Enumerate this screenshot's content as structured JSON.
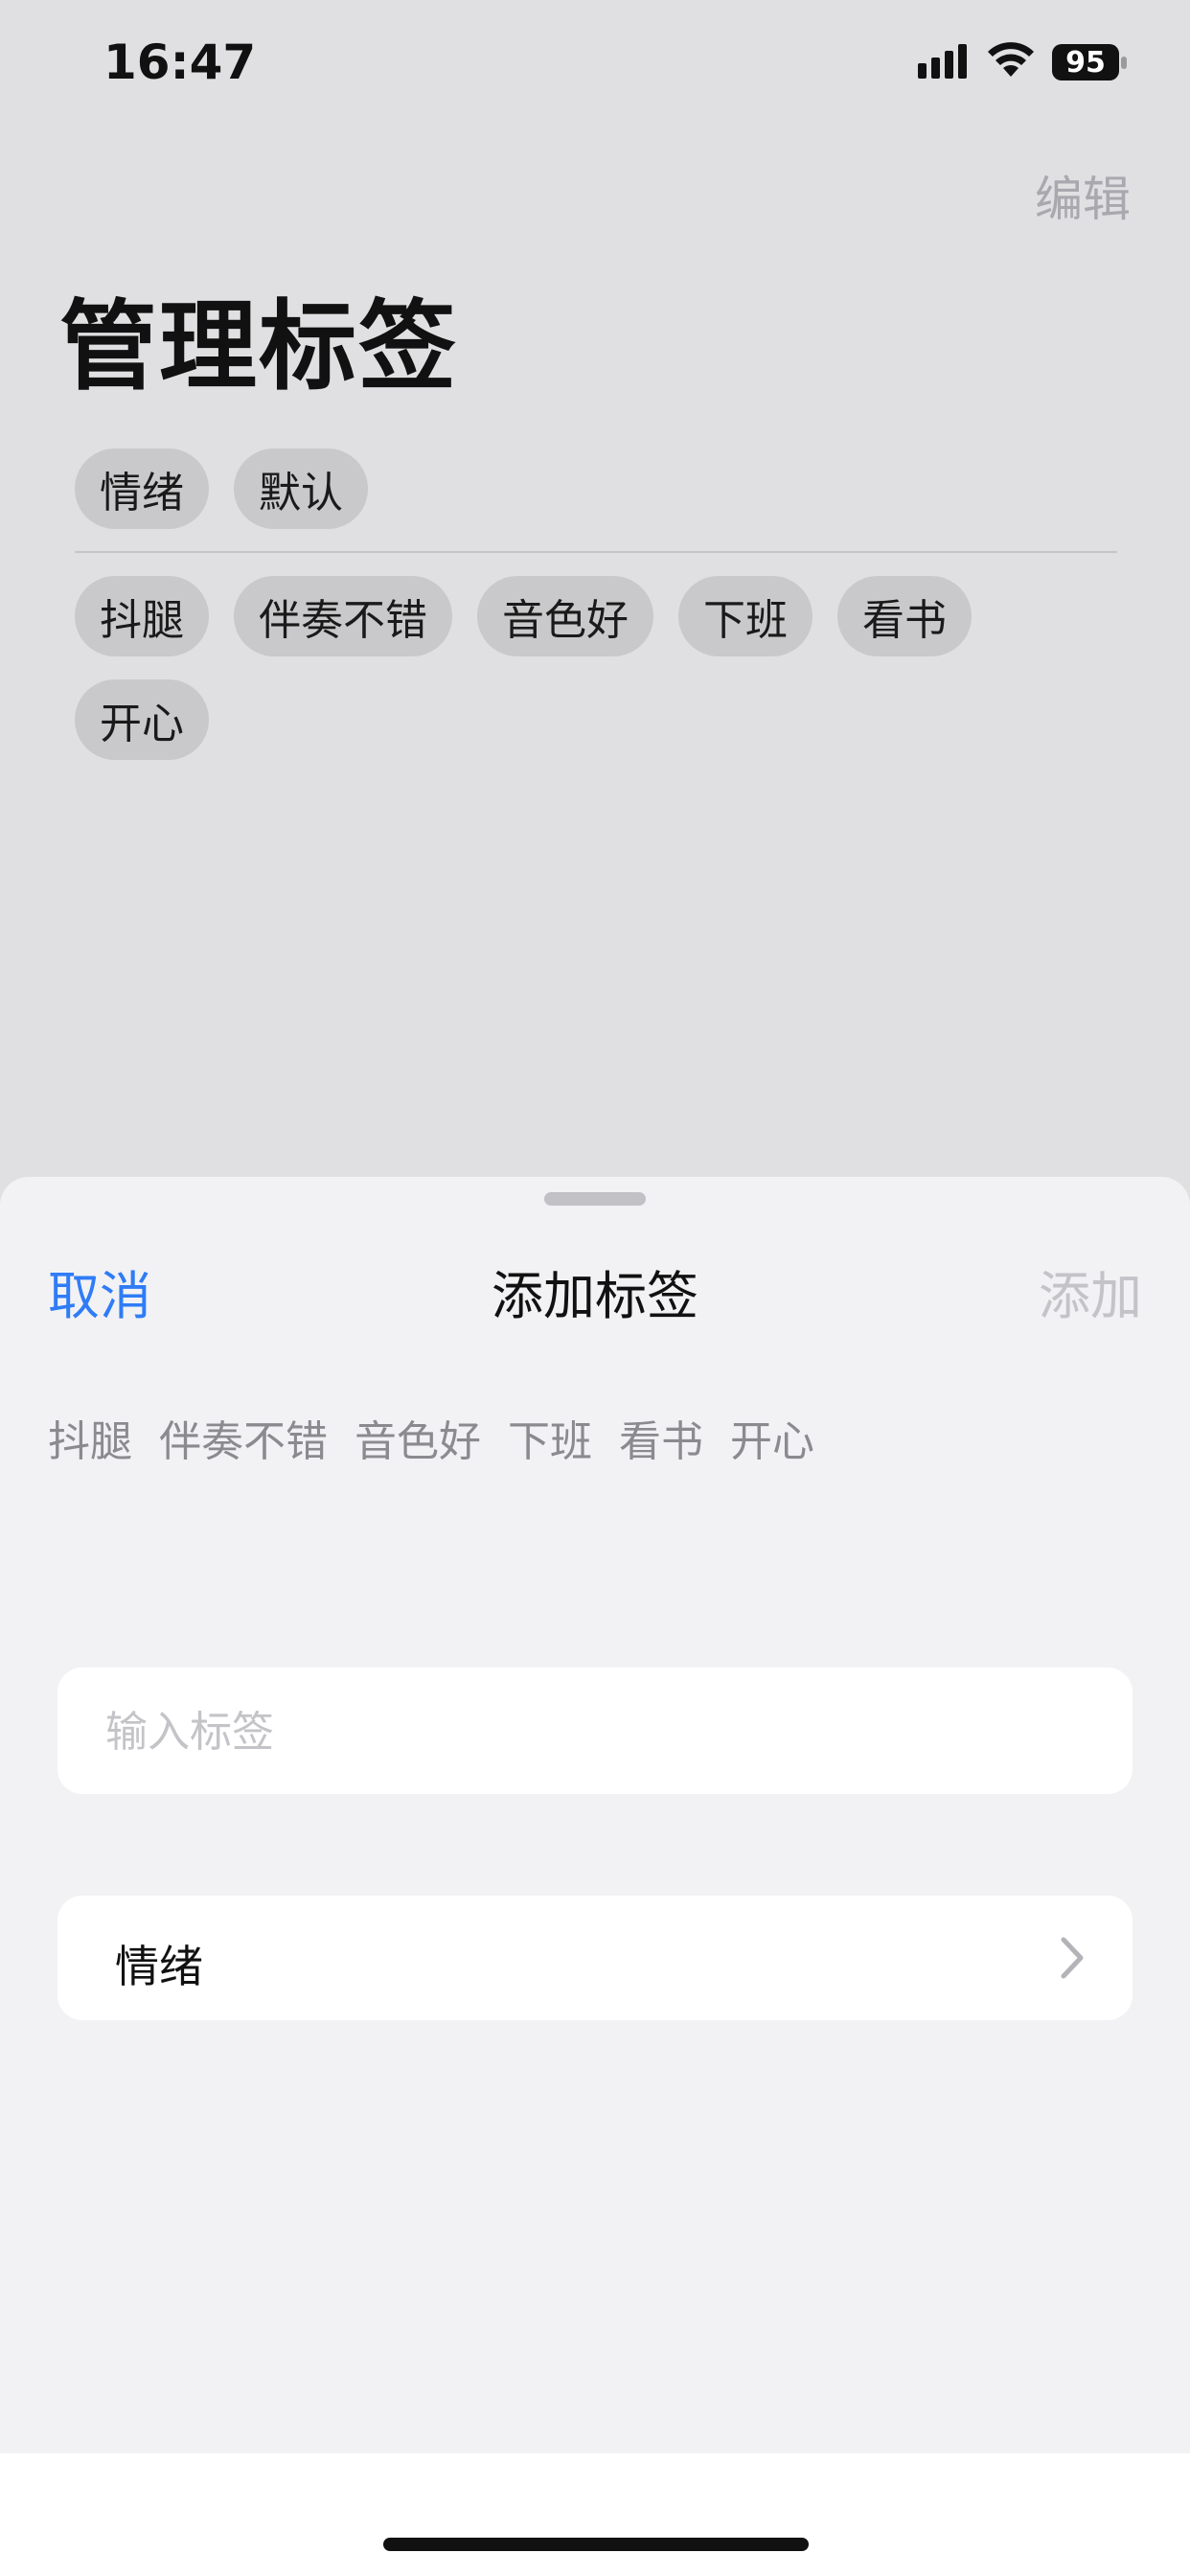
{
  "status_bar": {
    "time": "16:47",
    "battery": "95",
    "icons": [
      "cellular-signal-icon",
      "wifi-icon",
      "battery-icon"
    ]
  },
  "header": {
    "edit_label": "编辑",
    "title": "管理标签"
  },
  "tag_groups": {
    "row1": [
      "情绪",
      "默认"
    ],
    "row2": [
      "抖腿",
      "伴奏不错",
      "音色好",
      "下班",
      "看书",
      "开心"
    ]
  },
  "sheet": {
    "cancel_label": "取消",
    "title": "添加标签",
    "add_label": "添加",
    "suggestions": [
      "抖腿",
      "伴奏不错",
      "音色好",
      "下班",
      "看书",
      "开心"
    ],
    "input": {
      "value": "",
      "placeholder": "输入标签"
    },
    "group_selector": {
      "label": "情绪",
      "icon": "chevron-right-icon"
    }
  },
  "colors": {
    "accent": "#2f7cf6",
    "disabled": "#c4c4c8",
    "chip_bg": "#c9c9cb",
    "background_dimmed": "#e0e0e2",
    "sheet_bg": "#f2f2f4"
  }
}
